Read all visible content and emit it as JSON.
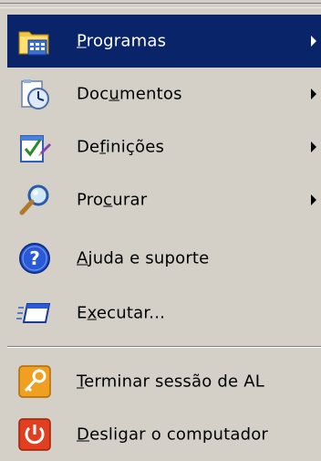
{
  "menu": {
    "items": [
      {
        "pre": "",
        "u": "P",
        "post": "rogramas",
        "has_submenu": true,
        "selected": true,
        "icon": "programs-folder-icon"
      },
      {
        "pre": "Doc",
        "u": "u",
        "post": "mentos",
        "has_submenu": true,
        "selected": false,
        "icon": "documents-clock-icon"
      },
      {
        "pre": "De",
        "u": "f",
        "post": "inições",
        "has_submenu": true,
        "selected": false,
        "icon": "settings-checklist-icon"
      },
      {
        "pre": "Pro",
        "u": "c",
        "post": "urar",
        "has_submenu": true,
        "selected": false,
        "icon": "search-magnifier-icon"
      },
      {
        "pre": "",
        "u": "A",
        "post": "juda e suporte",
        "has_submenu": false,
        "selected": false,
        "icon": "help-question-icon"
      },
      {
        "pre": "E",
        "u": "x",
        "post": "ecutar...",
        "has_submenu": false,
        "selected": false,
        "icon": "run-window-icon"
      },
      {
        "pre": "",
        "u": "T",
        "post": "erminar sessão de AL",
        "has_submenu": false,
        "selected": false,
        "icon": "logoff-key-icon"
      },
      {
        "pre": "",
        "u": "D",
        "post": "esligar o computador",
        "has_submenu": false,
        "selected": false,
        "icon": "shutdown-power-icon"
      }
    ]
  },
  "colors": {
    "selected_bg": "#0a246a",
    "menu_bg": "#d4d0c8"
  }
}
